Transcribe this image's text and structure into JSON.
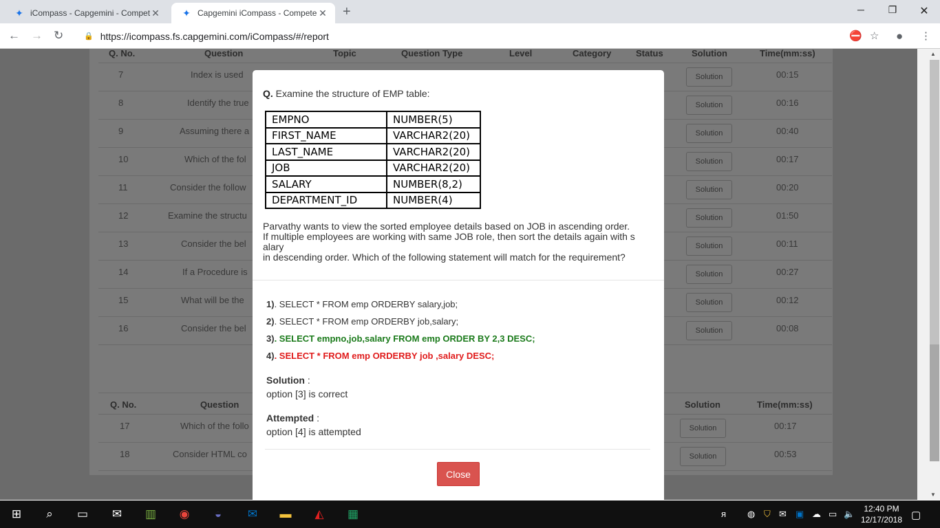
{
  "browser": {
    "tabs": [
      {
        "title": "iCompass - Capgemini - Compet",
        "active": false
      },
      {
        "title": "Capgemini iCompass - Competer",
        "active": true
      }
    ],
    "url": "https://icompass.fs.capgemini.com/iCompass/#/report"
  },
  "report": {
    "headers": [
      "Q. No.",
      "Question",
      "Topic",
      "Question Type",
      "Level",
      "Category",
      "Status",
      "Solution",
      "Time(mm:ss)"
    ],
    "rows": [
      {
        "no": "7",
        "question": "Index is used",
        "time": "00:15"
      },
      {
        "no": "8",
        "question": "Identify the true",
        "time": "00:16"
      },
      {
        "no": "9",
        "question": "Assuming there a",
        "time": "00:40"
      },
      {
        "no": "10",
        "question": "Which of the fol",
        "time": "00:17"
      },
      {
        "no": "11",
        "question": "Consider the follow",
        "time": "00:20"
      },
      {
        "no": "12",
        "question": "Examine the structu",
        "time": "01:50"
      },
      {
        "no": "13",
        "question": "Consider the bel",
        "time": "00:11"
      },
      {
        "no": "14",
        "question": "If a Procedure is",
        "time": "00:27"
      },
      {
        "no": "15",
        "question": "What will be the",
        "time": "00:12"
      },
      {
        "no": "16",
        "question": "Consider the bel",
        "time": "00:08"
      }
    ],
    "section2_headers": [
      "Q. No.",
      "Question",
      "Solution",
      "Time(mm:ss)"
    ],
    "rows2": [
      {
        "no": "17",
        "question": "Which of the follo",
        "time": "00:17"
      },
      {
        "no": "18",
        "question": "Consider HTML co",
        "time": "00:53"
      }
    ],
    "solution_label": "Solution"
  },
  "modal": {
    "q_prefix": "Q.",
    "q_text": "Examine the structure of EMP table:",
    "table": [
      [
        "EMPNO",
        "NUMBER(5)"
      ],
      [
        "FIRST_NAME",
        "VARCHAR2(20)"
      ],
      [
        "LAST_NAME",
        "VARCHAR2(20)"
      ],
      [
        "JOB",
        "VARCHAR2(20)"
      ],
      [
        "SALARY",
        "NUMBER(8,2)"
      ],
      [
        "DEPARTMENT_ID",
        "NUMBER(4)"
      ]
    ],
    "desc1": "Parvathy wants to view the sorted employee details based on JOB in ascending order.",
    "desc2": "If multiple employees are working with same JOB role, then sort the details again with s",
    "desc3": "alary",
    "desc4": "in descending order. Which of the following statement will match for the requirement?",
    "options": [
      {
        "num": "1)",
        "text": ". SELECT * FROM emp ORDERBY salary,job;"
      },
      {
        "num": "2)",
        "text": ". SELECT * FROM emp ORDERBY job,salary;"
      },
      {
        "num": "3)",
        "text": ". SELECT empno,job,salary FROM emp ORDER BY 2,3 DESC;"
      },
      {
        "num": "4)",
        "text": ". SELECT * FROM emp ORDERBY job ,salary DESC;"
      }
    ],
    "solution_label": "Solution",
    "solution_value": "option [3] is correct",
    "attempted_label": "Attempted",
    "attempted_value": "option [4] is attempted",
    "close_label": "Close"
  },
  "taskbar": {
    "time": "12:40 PM",
    "date": "12/17/2018"
  }
}
